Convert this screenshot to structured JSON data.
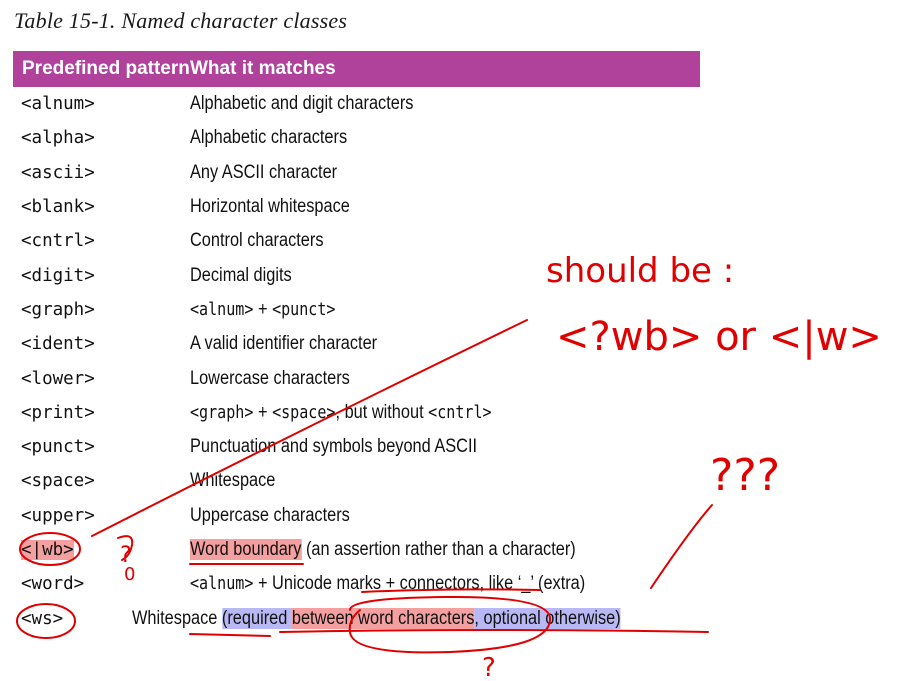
{
  "caption": "Table 15-1. Named character classes",
  "header": {
    "col1": "Predefined pattern",
    "col2": "What it matches"
  },
  "rows": [
    {
      "pattern": "<alnum>",
      "desc": "Alphabetic and digit characters"
    },
    {
      "pattern": "<alpha>",
      "desc": "Alphabetic characters"
    },
    {
      "pattern": "<ascii>",
      "desc": "Any ASCII character"
    },
    {
      "pattern": "<blank>",
      "desc": "Horizontal whitespace"
    },
    {
      "pattern": "<cntrl>",
      "desc": "Control characters"
    },
    {
      "pattern": "<digit>",
      "desc": "Decimal digits"
    },
    {
      "pattern": "<graph>",
      "desc_code1": "<alnum>",
      "desc_mid": " + ",
      "desc_code2": "<punct>"
    },
    {
      "pattern": "<ident>",
      "desc": "A valid identifier character"
    },
    {
      "pattern": "<lower>",
      "desc": "Lowercase characters"
    },
    {
      "pattern": "<print>",
      "desc_code1": "<graph>",
      "desc_mid": " + ",
      "desc_code2": "<space>",
      "desc_mid2": ", but without ",
      "desc_code3": "<cntrl>"
    },
    {
      "pattern": "<punct>",
      "desc": "Punctuation and symbols beyond ASCII"
    },
    {
      "pattern": "<space>",
      "desc": "Whitespace"
    },
    {
      "pattern": "<upper>",
      "desc": "Uppercase characters"
    },
    {
      "pattern": "<|wb>",
      "desc_a": "Word boundary",
      "desc_b": " (an assertion rather than a character)"
    },
    {
      "pattern": "<word>",
      "desc_code1": "<alnum>",
      "desc_mid": " + Unicode marks + connectors, like ‘_’ (extra)"
    },
    {
      "pattern": "<ws>",
      "desc_a": "Whitespace",
      "desc_sp": " ",
      "desc_b": "(required ",
      "desc_c": "between word characters",
      "desc_d": ",",
      "desc_e": " optional otherwise)"
    }
  ],
  "annotations": {
    "note_line1": "should be :",
    "note_line2": "<?wb> or <|w>",
    "question_marks": "???",
    "question_small": "?",
    "zero_mark": "0",
    "question_bottom": "?"
  },
  "colors": {
    "header_bg": "#b0429b",
    "ink": "#e10000",
    "highlight_red": "#f5a0a0",
    "highlight_blue": "#b8b8f4"
  }
}
